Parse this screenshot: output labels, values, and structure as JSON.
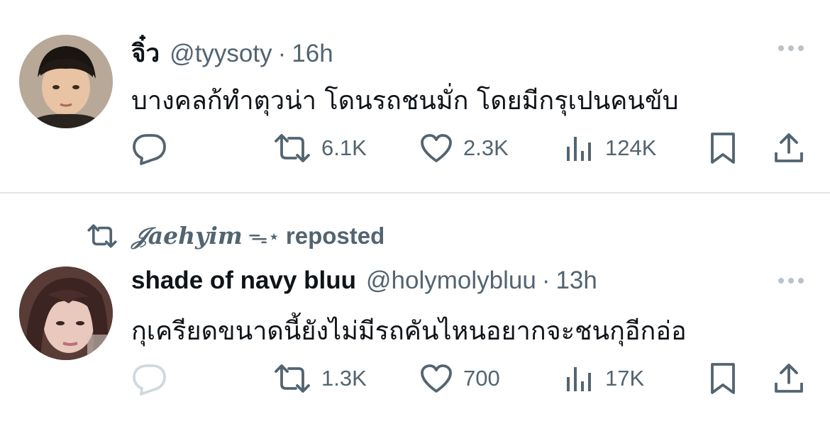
{
  "tweets": [
    {
      "author_name": "จิ๋ว",
      "handle": "@tyysoty",
      "separator": "·",
      "time": "16h",
      "text": "บางคลก้ทำตุวน่า โดนรถชนมั่ก โดยมีกรุเปนคนขับ",
      "reply_count": "",
      "retweet_count": "6.1K",
      "like_count": "2.3K",
      "view_count": "124K",
      "accent": "#536471"
    },
    {
      "repost_by": "𝒥aehyim",
      "repost_deco": "ᯓ⋆",
      "repost_label": "reposted",
      "author_name": "shade of navy bluu",
      "handle": "@holymolybluu",
      "separator": "·",
      "time": "13h",
      "text": "กุเครียดขนาดนี้ยังไม่มีรถคันไหนอยากจะชนกุอีกอ่อ",
      "reply_count": "",
      "retweet_count": "1.3K",
      "like_count": "700",
      "view_count": "17K",
      "reply_disabled_color": "#cfd9de"
    }
  ],
  "icons": [
    "reply-icon",
    "retweet-icon",
    "like-icon",
    "views-icon",
    "bookmark-icon",
    "share-icon",
    "more-icon",
    "repost-indicator-icon"
  ]
}
